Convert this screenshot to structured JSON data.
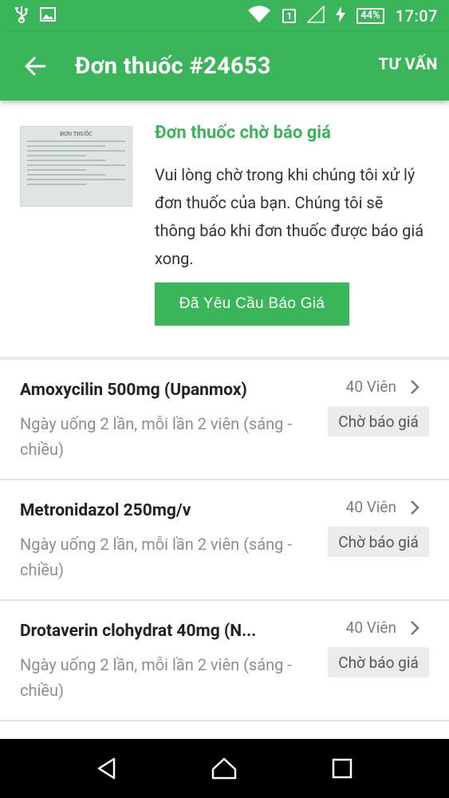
{
  "status_bar": {
    "time": "17:07",
    "battery": "44%",
    "sim": "1"
  },
  "app_bar": {
    "title": "Đơn thuốc #24653",
    "action": "TƯ VẤN"
  },
  "header": {
    "thumbnail_title": "ĐƠN THUỐC",
    "status_title": "Đơn thuốc chờ báo giá",
    "status_description": "Vui lòng chờ trong khi chúng tôi xử lý đơn thuốc của bạn. Chúng tôi sẽ thông báo khi đơn thuốc được báo giá xong.",
    "requested_button": "Đã Yêu Cầu Báo Giá"
  },
  "medications": [
    {
      "name": "Amoxycilin 500mg (Upanmox)",
      "dosage": "Ngày uống 2 lần, mỗi lần 2 viên (sáng - chiều)",
      "quantity": "40 Viên",
      "status": "Chờ báo giá"
    },
    {
      "name": "Metronidazol 250mg/v",
      "dosage": "Ngày uống 2 lần, mỗi lần 2 viên (sáng - chiều)",
      "quantity": "40 Viên",
      "status": "Chờ báo giá"
    },
    {
      "name": "Drotaverin clohydrat 40mg (N...",
      "dosage": "Ngày uống 2 lần, mỗi lần 2 viên (sáng - chiều)",
      "quantity": "40 Viên",
      "status": "Chờ báo giá"
    }
  ],
  "colors": {
    "primary": "#3bb55a",
    "badge_bg": "#ececec",
    "nav_bg": "#000000"
  }
}
